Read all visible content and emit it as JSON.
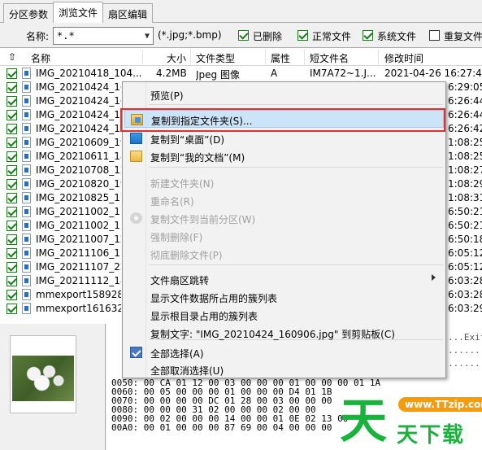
{
  "tabs": [
    {
      "label": "分区参数",
      "active": false
    },
    {
      "label": "浏览文件",
      "active": true
    },
    {
      "label": "扇区编辑",
      "active": false
    }
  ],
  "filter": {
    "name_label": "名称:",
    "name_value": "*.*",
    "ext_hint": "(*.jpg;*.bmp)",
    "options": [
      {
        "label": "已删除",
        "checked": true
      },
      {
        "label": "正常文件",
        "checked": true
      },
      {
        "label": "系统文件",
        "checked": true
      },
      {
        "label": "重复文件",
        "checked": false
      }
    ]
  },
  "columns": {
    "name": "名称",
    "size": "大小",
    "type": "文件类型",
    "attr": "属性",
    "short": "短文件名",
    "mtime": "修改时间"
  },
  "files": [
    {
      "name": "IMG_20210418_104...",
      "size": "4.2MB",
      "type": "Jpeg 图像",
      "attr": "A",
      "short": "IM7A72~1.J...",
      "mtime": "2021-04-26 16:27:47"
    },
    {
      "name": "IMG_20210424_160",
      "mtime_tail": "6:29:05"
    },
    {
      "name": "IMG_20210424_160",
      "mtime_tail": "6:26:44"
    },
    {
      "name": "IMG_20210424_160",
      "mtime_tail": "6:26:44"
    },
    {
      "name": "IMG_20210424_160",
      "mtime_tail": "6:26:42"
    },
    {
      "name": "IMG_20210609_190",
      "mtime_tail": "1:08:25"
    },
    {
      "name": "IMG_20210611_182",
      "mtime_tail": "1:08:25"
    },
    {
      "name": "IMG_20210708_120",
      "mtime_tail": "1:08:27"
    },
    {
      "name": "IMG_20210820_190",
      "mtime_tail": "1:08:29"
    },
    {
      "name": "IMG_20210825_175",
      "mtime_tail": "1:08:31"
    },
    {
      "name": "IMG_20211002_113",
      "mtime_tail": "6:50:21"
    },
    {
      "name": "IMG_20211002_113",
      "mtime_tail": "6:50:21"
    },
    {
      "name": "IMG_20211007_122",
      "mtime_tail": "6:50:18"
    },
    {
      "name": "IMG_20211106_113",
      "mtime_tail": "6:05:12"
    },
    {
      "name": "IMG_20211107_222",
      "mtime_tail": "6:05:12"
    },
    {
      "name": "IMG_20211112_181",
      "mtime_tail": "6:03:28"
    },
    {
      "name": "mmexport1589282",
      "mtime_tail": "6:03:28"
    },
    {
      "name": "mmexport1616324",
      "mtime_tail": "6:03:29"
    }
  ],
  "context_menu": {
    "items": [
      {
        "label": "预览(P)",
        "disabled": false,
        "icon": ""
      },
      {
        "label": "复制到指定文件夹(S)...",
        "disabled": false,
        "icon": "copy-to-folder-icon",
        "highlighted": true
      },
      {
        "label": "复制到“桌面”(D)",
        "disabled": false,
        "icon": "desktop-icon"
      },
      {
        "label": "复制到“我的文档”(M)",
        "disabled": false,
        "icon": "folder-icon"
      },
      {
        "label": "新建文件夹(N)",
        "disabled": true,
        "icon": ""
      },
      {
        "label": "重命名(R)",
        "disabled": true,
        "icon": ""
      },
      {
        "label": "复制文件到当前分区(W)",
        "disabled": true,
        "icon": "disk-icon"
      },
      {
        "label": "强制删除(F)",
        "disabled": true,
        "icon": ""
      },
      {
        "label": "彻底删除文件(P)",
        "disabled": true,
        "icon": ""
      },
      {
        "label": "文件扇区跳转",
        "disabled": false,
        "icon": "",
        "submenu": true
      },
      {
        "label": "显示文件数据所占用的簇列表",
        "disabled": false,
        "icon": ""
      },
      {
        "label": "显示根目录占用的簇列表",
        "disabled": false,
        "icon": ""
      },
      {
        "label": "复制文字: \"IMG_20210424_160906.jpg\" 到剪贴板(C)",
        "disabled": false,
        "icon": ""
      },
      {
        "label": "全部选择(A)",
        "disabled": false,
        "icon": "select-all-icon"
      },
      {
        "label": "全部取消选择(U)",
        "disabled": false,
        "icon": ""
      }
    ]
  },
  "hex": {
    "lines": [
      "0050: 00 CA 01 12 00 03 00 00 00 01 00 00 00 01 1A",
      "0060: 00 05 00 00 00 01 00 00 00 D4 01 1B",
      "0070: 00 00 00 00 DC 01 28 00 03 00 00 00",
      "0080: 00 00 00 31 02 00 00 00 02 00 00",
      "0090: 00 02 00 00 00 14 00 00 01 0E 02 13 00",
      "00A0: 00 01 00 00 00 87 69 00 04 00 00 00"
    ],
    "right": [
      "...Exif",
      "........",
      "........"
    ]
  },
  "watermark": {
    "big": "天",
    "url": "www.TTzip.com",
    "sub": "天下载"
  },
  "colors": {
    "accent": "#e2302f",
    "highlight": "#cce4f7",
    "check": "#1a7a1a",
    "watermark": "#19b23a"
  }
}
